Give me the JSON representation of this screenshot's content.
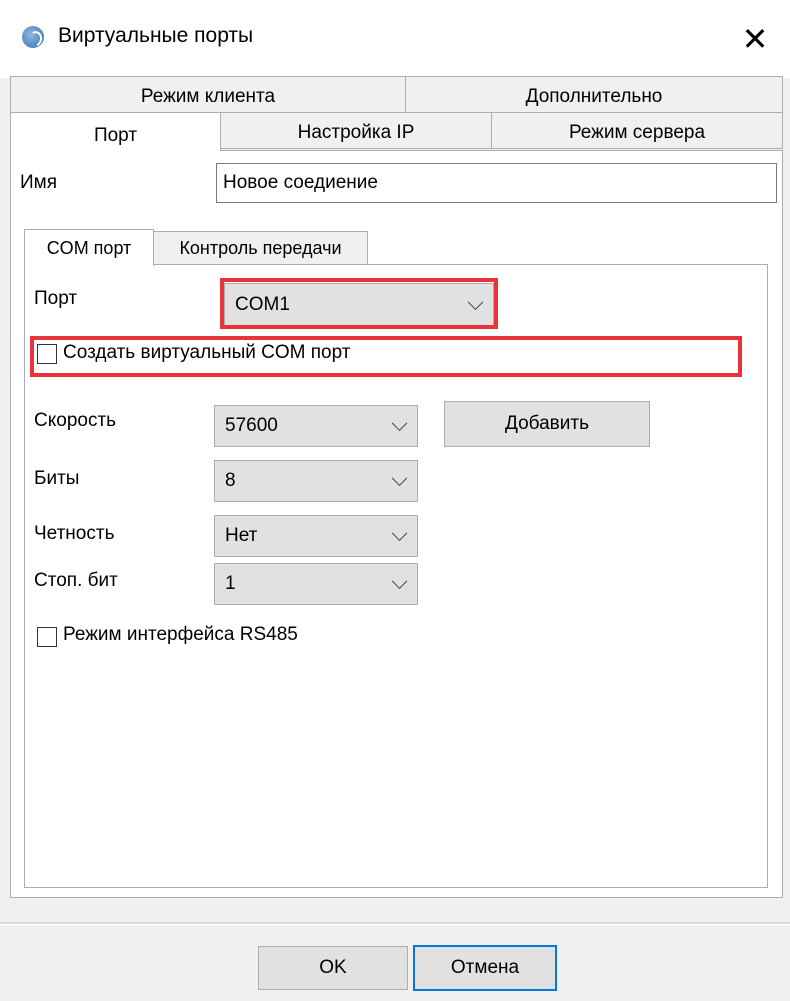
{
  "window": {
    "title": "Виртуальные порты",
    "close_symbol": "✕"
  },
  "tabs": {
    "row_top": [
      "Режим клиента",
      "Дополнительно"
    ],
    "row_bottom": [
      "Порт",
      "Настройка IP",
      "Режим сервера"
    ],
    "active": "Порт"
  },
  "name_field": {
    "label": "Имя",
    "value": "Новое соедиение"
  },
  "inner_tabs": {
    "items": [
      "COM порт",
      "Контроль передачи"
    ],
    "active": "COM порт"
  },
  "port": {
    "label": "Порт",
    "value": "COM1"
  },
  "virtual_com": {
    "label": "Создать виртуальный COM порт",
    "checked": false
  },
  "speed": {
    "label": "Скорость",
    "value": "57600"
  },
  "add_button": "Добавить",
  "bits": {
    "label": "Биты",
    "value": "8"
  },
  "parity": {
    "label": "Четность",
    "value": "Нет"
  },
  "stop_bits": {
    "label": "Стоп. бит",
    "value": "1"
  },
  "rs485": {
    "label": "Режим интерфейса RS485",
    "checked": false
  },
  "footer": {
    "ok": "OK",
    "cancel": "Отмена"
  },
  "colors": {
    "highlight": "#e8333b",
    "default_button_border": "#0078d7"
  }
}
